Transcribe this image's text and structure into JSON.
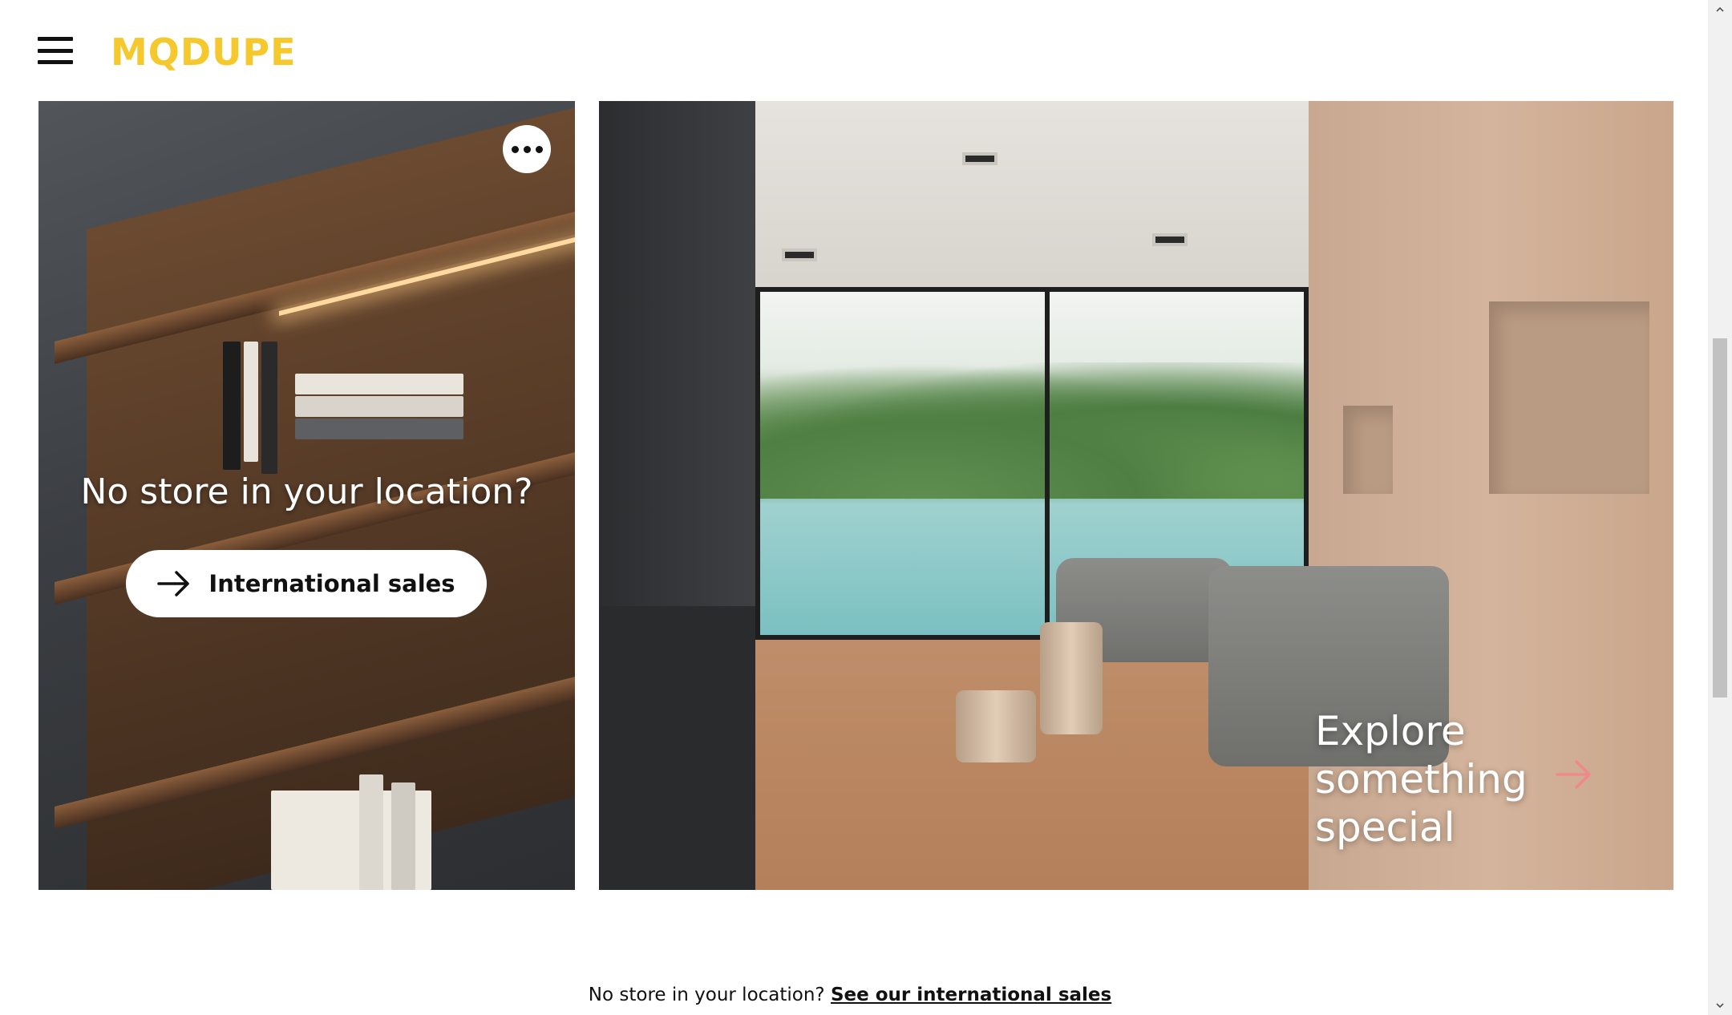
{
  "header": {
    "menu_icon": "hamburger-menu-icon",
    "logo_text": "MQDUPE",
    "logo_color": "#f5c82e"
  },
  "promo_left": {
    "more_icon": "more-options-icon",
    "title": "No store in your location?",
    "button_label": "International sales",
    "button_icon": "arrow-right-icon"
  },
  "promo_right": {
    "headline_line1": "Explore",
    "headline_line2": "something",
    "headline_line3": "special",
    "arrow_icon": "arrow-right-icon",
    "arrow_color": "#f08a8a"
  },
  "footer": {
    "text": "No store in your location?",
    "link_label": "See our international sales"
  }
}
